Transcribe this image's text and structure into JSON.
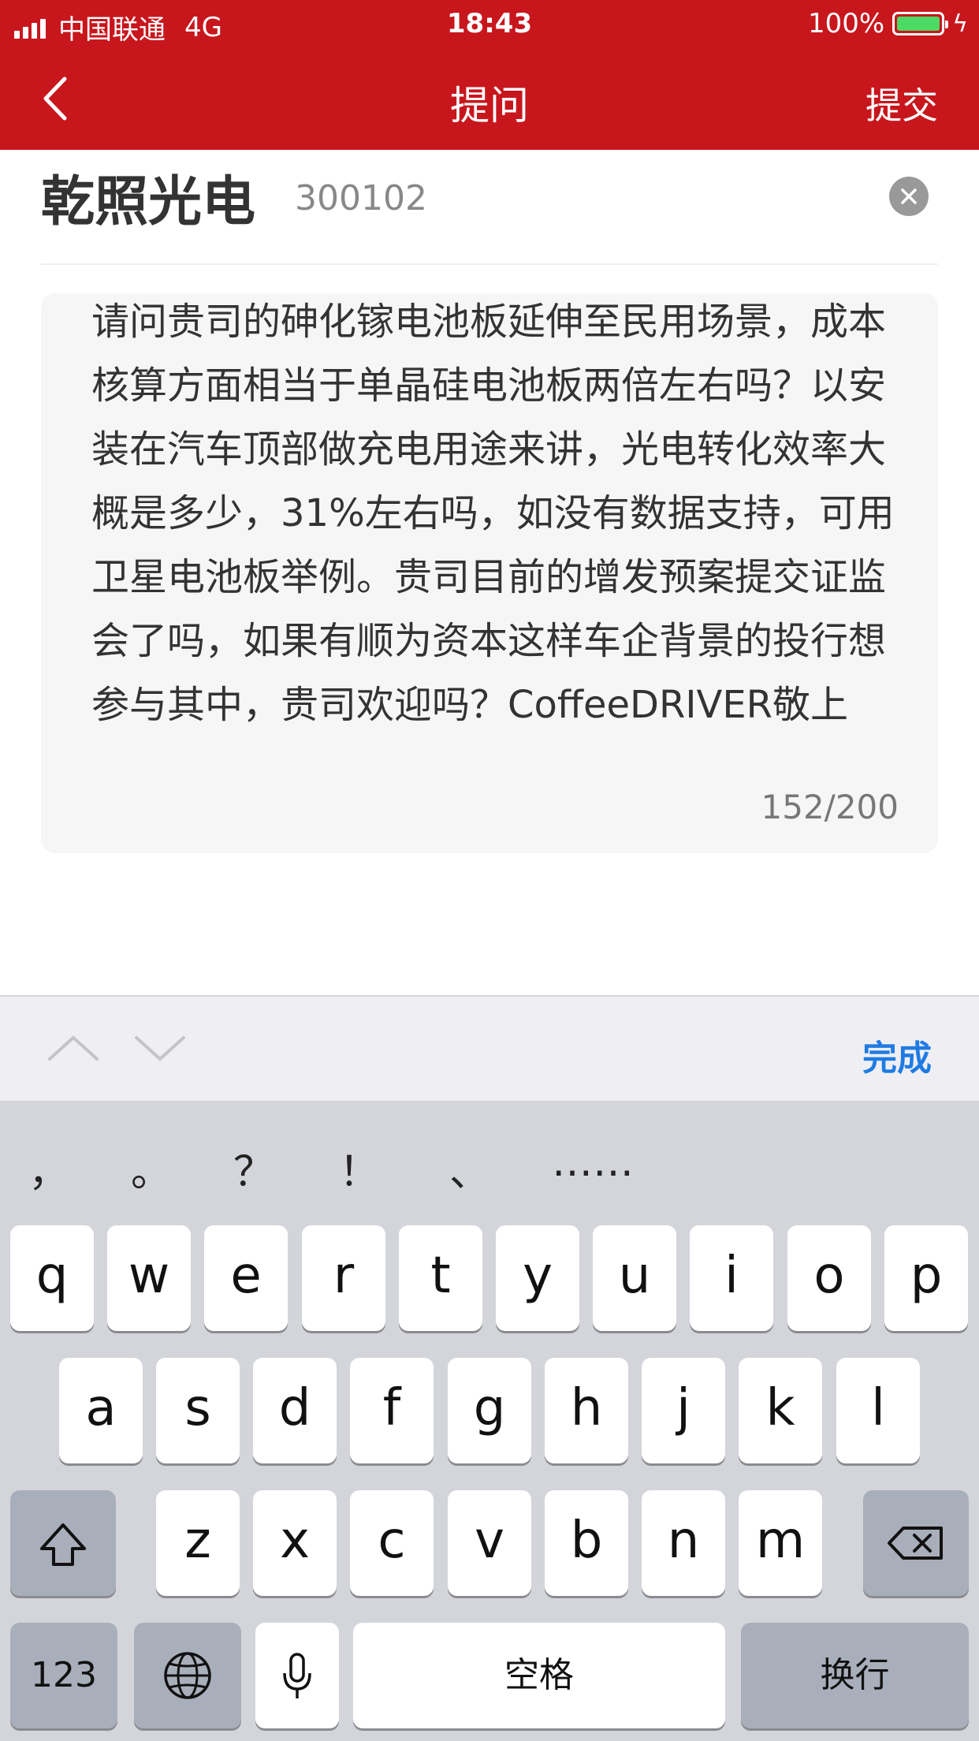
{
  "status_bar": {
    "carrier": "中国联通",
    "network": "4G",
    "time": "18:43",
    "battery": "100%",
    "battery_color": "#4cd964"
  },
  "nav": {
    "title": "提问",
    "submit_label": "提交",
    "back_icon": "chevron-left-icon",
    "bar_color": "#c8161d"
  },
  "stock": {
    "name": "乾照光电",
    "code": "300102",
    "clear_icon": "clear-circle-icon"
  },
  "question": {
    "text": "请问贵司的砷化镓电池板延伸至民用场景，成本核算方面相当于单晶硅电池板两倍左右吗？以安装在汽车顶部做充电用途来讲，光电转化效率大概是多少，31%左右吗，如没有数据支持，可用卫星电池板举例。贵司目前的增发预案提交证监会了吗，如果有顺为资本这样车企背景的投行想参与其中，贵司欢迎吗？CoffeeDRIVER敬上",
    "counter": "152/200"
  },
  "keyboard_toolbar": {
    "done_label": "完成",
    "done_color": "#1f7be3"
  },
  "keyboard": {
    "punctuation": [
      "，",
      "。",
      "？",
      "！",
      "、",
      "……"
    ],
    "row1": [
      "q",
      "w",
      "e",
      "r",
      "t",
      "y",
      "u",
      "i",
      "o",
      "p"
    ],
    "row2": [
      "a",
      "s",
      "d",
      "f",
      "g",
      "h",
      "j",
      "k",
      "l"
    ],
    "row3": [
      "z",
      "x",
      "c",
      "v",
      "b",
      "n",
      "m"
    ],
    "numbers_label": "123",
    "space_label": "空格",
    "return_label": "换行"
  }
}
